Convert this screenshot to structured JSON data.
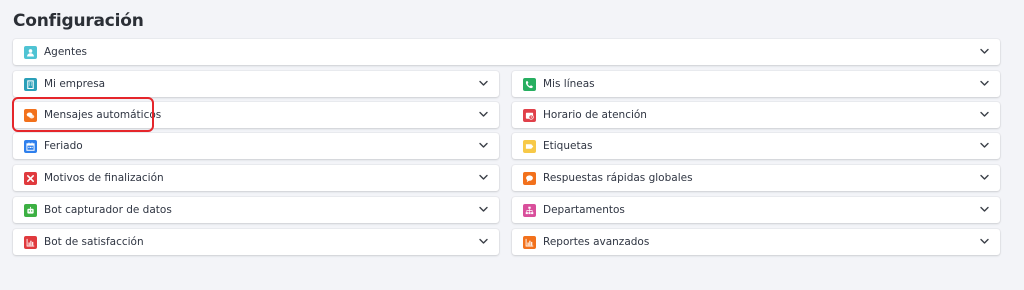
{
  "page": {
    "title": "Configuración"
  },
  "full_items": [
    {
      "label": "Agentes",
      "icon": "user-icon",
      "color": "#4fc3d3"
    }
  ],
  "left_items": [
    {
      "label": "Mi empresa",
      "icon": "building-icon",
      "color": "#2a9fb8"
    },
    {
      "label": "Mensajes automáticos",
      "icon": "chat-bubbles-icon",
      "color": "#f2711c"
    },
    {
      "label": "Feriado",
      "icon": "calendar-icon",
      "color": "#2f80ed"
    },
    {
      "label": "Motivos de finalización",
      "icon": "close-x-icon",
      "color": "#e03a3e"
    },
    {
      "label": "Bot capturador de datos",
      "icon": "robot-icon",
      "color": "#3cb043"
    },
    {
      "label": "Bot de satisfacción",
      "icon": "bar-chart-icon",
      "color": "#e03a3e"
    }
  ],
  "right_items": [
    {
      "label": "Mis líneas",
      "icon": "phone-icon",
      "color": "#27ae60"
    },
    {
      "label": "Horario de atención",
      "icon": "clock-icon",
      "color": "#e0404a"
    },
    {
      "label": "Etiquetas",
      "icon": "tag-icon",
      "color": "#f7c948"
    },
    {
      "label": "Respuestas rápidas globales",
      "icon": "speech-bubble-icon",
      "color": "#f2711c"
    },
    {
      "label": "Departamentos",
      "icon": "org-chart-icon",
      "color": "#d94f9b"
    },
    {
      "label": "Reportes avanzados",
      "icon": "bar-chart-icon",
      "color": "#f2711c"
    }
  ],
  "highlighted_item": "Mensajes automáticos",
  "colors": {
    "highlight": "#e5262b",
    "background": "#f3f4f8"
  }
}
